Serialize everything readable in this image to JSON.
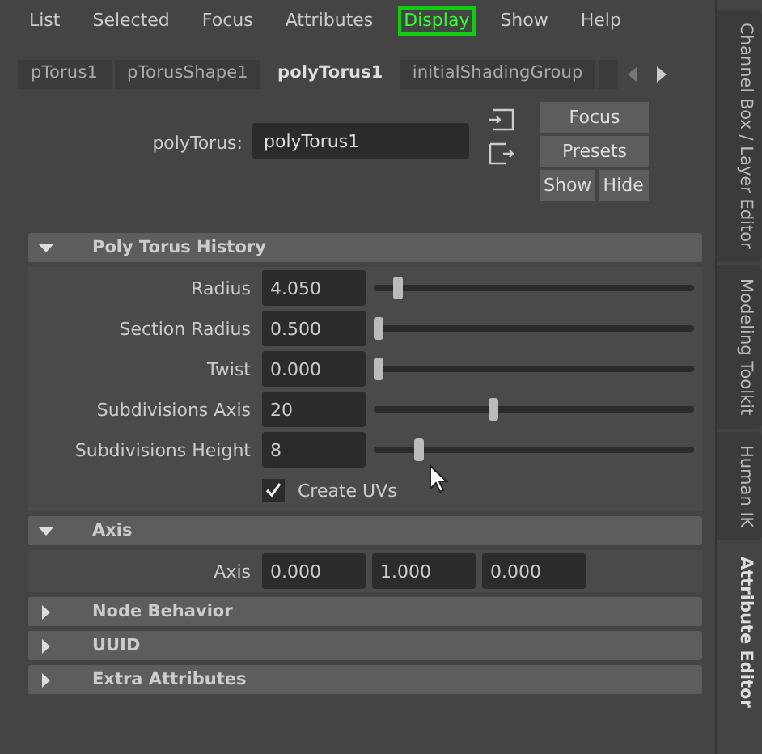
{
  "menu": [
    {
      "label": "List",
      "highlighted": false
    },
    {
      "label": "Selected",
      "highlighted": false
    },
    {
      "label": "Focus",
      "highlighted": false
    },
    {
      "label": "Attributes",
      "highlighted": false
    },
    {
      "label": "Display",
      "highlighted": true
    },
    {
      "label": "Show",
      "highlighted": false
    },
    {
      "label": "Help",
      "highlighted": false
    }
  ],
  "tabs": [
    {
      "label": "pTorus1",
      "selected": false
    },
    {
      "label": "pTorusShape1",
      "selected": false
    },
    {
      "label": "polyTorus1",
      "selected": true
    },
    {
      "label": "initialShadingGroup",
      "selected": false
    }
  ],
  "node": {
    "label": "polyTorus:",
    "value": "polyTorus1"
  },
  "buttons": {
    "focus": "Focus",
    "presets": "Presets",
    "show": "Show",
    "hide": "Hide"
  },
  "sections": [
    {
      "title": "Poly Torus History",
      "expanded": true,
      "rows": [
        {
          "kind": "slider",
          "label": "Radius",
          "value": "4.050",
          "level": 0.06
        },
        {
          "kind": "slider",
          "label": "Section Radius",
          "value": "0.500",
          "level": 0
        },
        {
          "kind": "slider",
          "label": "Twist",
          "value": "0.000",
          "level": 0
        },
        {
          "kind": "slider",
          "label": "Subdivisions Axis",
          "value": "20",
          "level": 0.37
        },
        {
          "kind": "slider",
          "label": "Subdivisions Height",
          "value": "8",
          "level": 0.13
        },
        {
          "kind": "checkbox",
          "label": "Create UVs",
          "checked": true
        }
      ]
    },
    {
      "title": "Axis",
      "expanded": true,
      "rows": [
        {
          "kind": "vector",
          "label": "Axis",
          "values": [
            "0.000",
            "1.000",
            "0.000"
          ]
        }
      ]
    },
    {
      "title": "Node Behavior",
      "expanded": false
    },
    {
      "title": "UUID",
      "expanded": false
    },
    {
      "title": "Extra Attributes",
      "expanded": false
    }
  ],
  "side_tabs": [
    {
      "label": "Channel Box / Layer Editor",
      "selected": false
    },
    {
      "label": "Modeling Toolkit",
      "selected": false
    },
    {
      "label": "Human IK",
      "selected": false
    },
    {
      "label": "Attribute Editor",
      "selected": true
    }
  ]
}
